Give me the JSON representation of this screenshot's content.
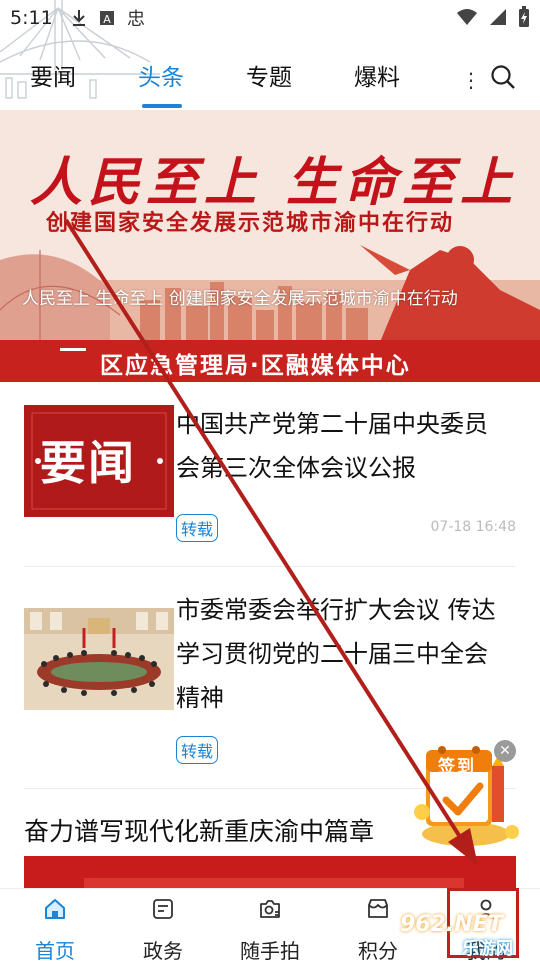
{
  "status_bar": {
    "time": "5:11",
    "icons_left": [
      "download-icon",
      "a-badge-icon",
      "bug-icon"
    ],
    "icons_right": [
      "wifi-icon",
      "signal-icon",
      "battery-icon"
    ]
  },
  "top_tabs": {
    "items": [
      "要闻",
      "头条",
      "专题",
      "爆料"
    ],
    "active_index": 1,
    "more": "⋮"
  },
  "banner": {
    "title_line1": "人民至上 生命至上",
    "title_line2": "创建国家安全发展示范城市渝中在行动",
    "caption": "人民至上 生命至上 创建国家安全发展示范城市渝中在行动",
    "footer": "区应急管理局·区融媒体中心"
  },
  "news": [
    {
      "title": "中国共产党第二十届中央委员会第三次全体会议公报",
      "thumb_text": "要闻",
      "tag": "转载",
      "time": "07-18 16:48"
    },
    {
      "title": "市委常委会举行扩大会议 传达学习贯彻党的二十届三中全会精神",
      "tag": "转载"
    }
  ],
  "feature_title": "奋力谱写现代化新重庆渝中篇章",
  "checkin": {
    "label": "签到"
  },
  "bottom_nav": {
    "items": [
      {
        "label": "首页",
        "icon": "home-icon"
      },
      {
        "label": "政务",
        "icon": "document-icon"
      },
      {
        "label": "随手拍",
        "icon": "camera-icon"
      },
      {
        "label": "积分",
        "icon": "store-icon"
      },
      {
        "label": "我的",
        "icon": "user-icon"
      }
    ],
    "active_index": 0
  },
  "watermark": {
    "main": "962.NET",
    "sub": "乐游网"
  },
  "colors": {
    "accent": "#1b84d6",
    "brand_red": "#c8221e",
    "annotation": "#c0201c"
  }
}
